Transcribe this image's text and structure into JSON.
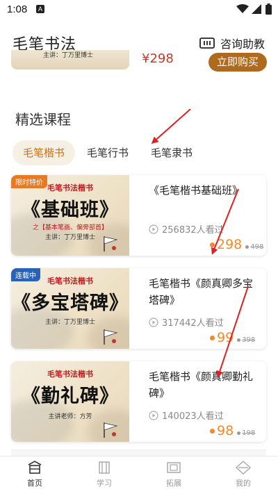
{
  "status_bar": {
    "time": "1:08",
    "notif_icon": "A"
  },
  "header": {
    "title": "毛笔书法",
    "consult_label": "咨询助教"
  },
  "sticky_course": {
    "lecturer_caption": "主讲：丁万里博士",
    "price": "¥298",
    "buy_label": "立即购买"
  },
  "section_title": "精选课程",
  "tabs": [
    {
      "label": "毛笔楷书",
      "active": true
    },
    {
      "label": "毛笔行书",
      "active": false
    },
    {
      "label": "毛笔隶书",
      "active": false
    }
  ],
  "courses": [
    {
      "badge": "限时特价",
      "badge_color": "#e77a24",
      "cover_series": "毛笔书法楷书",
      "cover_title": "《基础班》",
      "cover_subtitle": "之【基本笔画、偏旁部首】",
      "cover_lecturer": "主讲：丁万里博士",
      "title": "《毛笔楷书基础班》",
      "views": "256832人看过",
      "price": "298",
      "original_price": "498"
    },
    {
      "badge": "连载中",
      "badge_color": "#2a62b8",
      "cover_series": "毛笔书法楷书",
      "cover_title": "《多宝塔碑》",
      "cover_subtitle": "",
      "cover_lecturer": "主讲：丁万里博士",
      "title": "毛笔楷书《颜真卿多宝塔碑》",
      "views": "317442人看过",
      "price": "99",
      "original_price": "398"
    },
    {
      "badge": "",
      "badge_color": "",
      "cover_series": "毛笔书法楷书",
      "cover_title": "《勤礼碑》",
      "cover_subtitle": "",
      "cover_lecturer": "主讲老师：方芳",
      "title": "毛笔楷书《颜真卿勤礼碑》",
      "views": "140023人看过",
      "price": "98",
      "original_price": "198"
    }
  ],
  "bottom_nav": [
    {
      "label": "首页",
      "icon": "home-icon",
      "active": true
    },
    {
      "label": "学习",
      "icon": "book-icon",
      "active": false
    },
    {
      "label": "拓展",
      "icon": "scroll-icon",
      "active": false
    },
    {
      "label": "我的",
      "icon": "profile-icon",
      "active": false
    }
  ],
  "colors": {
    "accent": "#c8731a",
    "buy_button": "#b06a1e",
    "price_orange": "#f08a2c",
    "price_red": "#c0392b",
    "annotation_red": "#e02020"
  }
}
